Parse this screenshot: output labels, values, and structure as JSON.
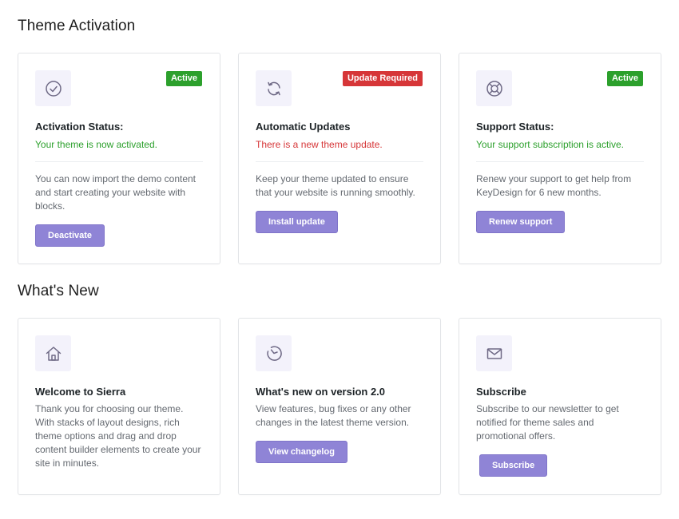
{
  "sections": {
    "activation_title": "Theme Activation",
    "whats_new_title": "What's New"
  },
  "colors": {
    "accent": "#8f84d6",
    "success": "#2ca02c",
    "danger": "#d63638",
    "icon_bg": "#f3f2fb"
  },
  "activation_cards": [
    {
      "icon": "check-circle-icon",
      "badge": "Active",
      "title": "Activation Status:",
      "status": "Your theme is now activated.",
      "description": "You can now import the demo content and start creating your website with blocks.",
      "button": "Deactivate"
    },
    {
      "icon": "refresh-icon",
      "badge": "Update Required",
      "title": "Automatic Updates",
      "status": "There is a new theme update.",
      "description": "Keep your theme updated to ensure that your website is running smoothly.",
      "button": "Install update"
    },
    {
      "icon": "lifebuoy-icon",
      "badge": "Active",
      "title": "Support Status:",
      "status": "Your support subscription is active.",
      "description": "Renew your support to get help from KeyDesign for 6 new months.",
      "button": "Renew support"
    }
  ],
  "whats_new_cards": [
    {
      "icon": "home-icon",
      "title": "Welcome to Sierra",
      "description": "Thank you for choosing our theme. With stacks of layout designs, rich theme options and drag and drop content builder elements to create your site in minutes."
    },
    {
      "icon": "history-icon",
      "title": "What's new on version 2.0",
      "description": "View features, bug fixes or any other changes in the latest theme version.",
      "button": "View changelog"
    },
    {
      "icon": "envelope-icon",
      "title": "Subscribe",
      "description": "Subscribe to our newsletter to get notified for theme sales and promotional offers.",
      "button": "Subscribe"
    }
  ]
}
